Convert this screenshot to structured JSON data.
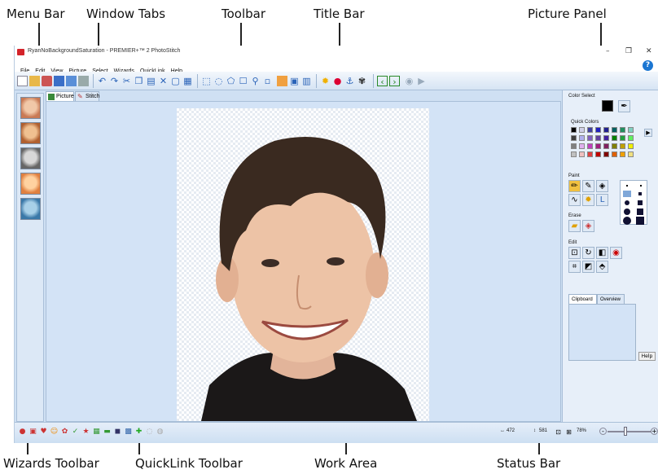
{
  "callouts": {
    "menu_bar": "Menu Bar",
    "window_tabs": "Window Tabs",
    "toolbar": "Toolbar",
    "title_bar": "Title Bar",
    "picture_panel": "Picture Panel",
    "wizards_toolbar": "Wizards Toolbar",
    "quicklink_toolbar": "QuickLink Toolbar",
    "work_area": "Work Area",
    "status_bar": "Status Bar"
  },
  "window": {
    "title": "RyanNoBackgroundSaturation - PREMIER+™ 2 PhotoStitch",
    "minimize": "–",
    "restore": "❐",
    "close": "✕",
    "help": "?"
  },
  "menu": [
    "File",
    "Edit",
    "View",
    "Picture",
    "Select",
    "Wizards",
    "QuickLink",
    "Help"
  ],
  "tabs": [
    {
      "label": "Picture",
      "active": true
    },
    {
      "label": "Stitch",
      "active": false
    }
  ],
  "panel": {
    "color_select": "Color Select",
    "quick_colors": "Quick Colors",
    "paint": "Paint",
    "erase": "Erase",
    "edit": "Edit",
    "clipboard_tab": "Clipboard",
    "overview_tab": "Overview",
    "help_button": "Help"
  },
  "quick_colors": [
    "#000000",
    "#d0d0e8",
    "#4040a0",
    "#2020c0",
    "#202090",
    "#006060",
    "#209060",
    "#80d0c0",
    "#404040",
    "#b0b0f0",
    "#8060c0",
    "#6040a0",
    "#4020a0",
    "#008000",
    "#20a040",
    "#60f060",
    "#808080",
    "#e0b0f0",
    "#c040c0",
    "#a02080",
    "#802060",
    "#808000",
    "#c0a000",
    "#f0f000",
    "#c0c0c0",
    "#f0c0c0",
    "#e04040",
    "#c00000",
    "#800000",
    "#e06000",
    "#f0a000",
    "#f0e080"
  ],
  "status": {
    "x_coord": "472",
    "y_coord": "581",
    "zoom": "78%"
  },
  "colors": {
    "foreground": "#000000",
    "accent": "#1b76d2",
    "work_bg": "#d3e3f6"
  }
}
